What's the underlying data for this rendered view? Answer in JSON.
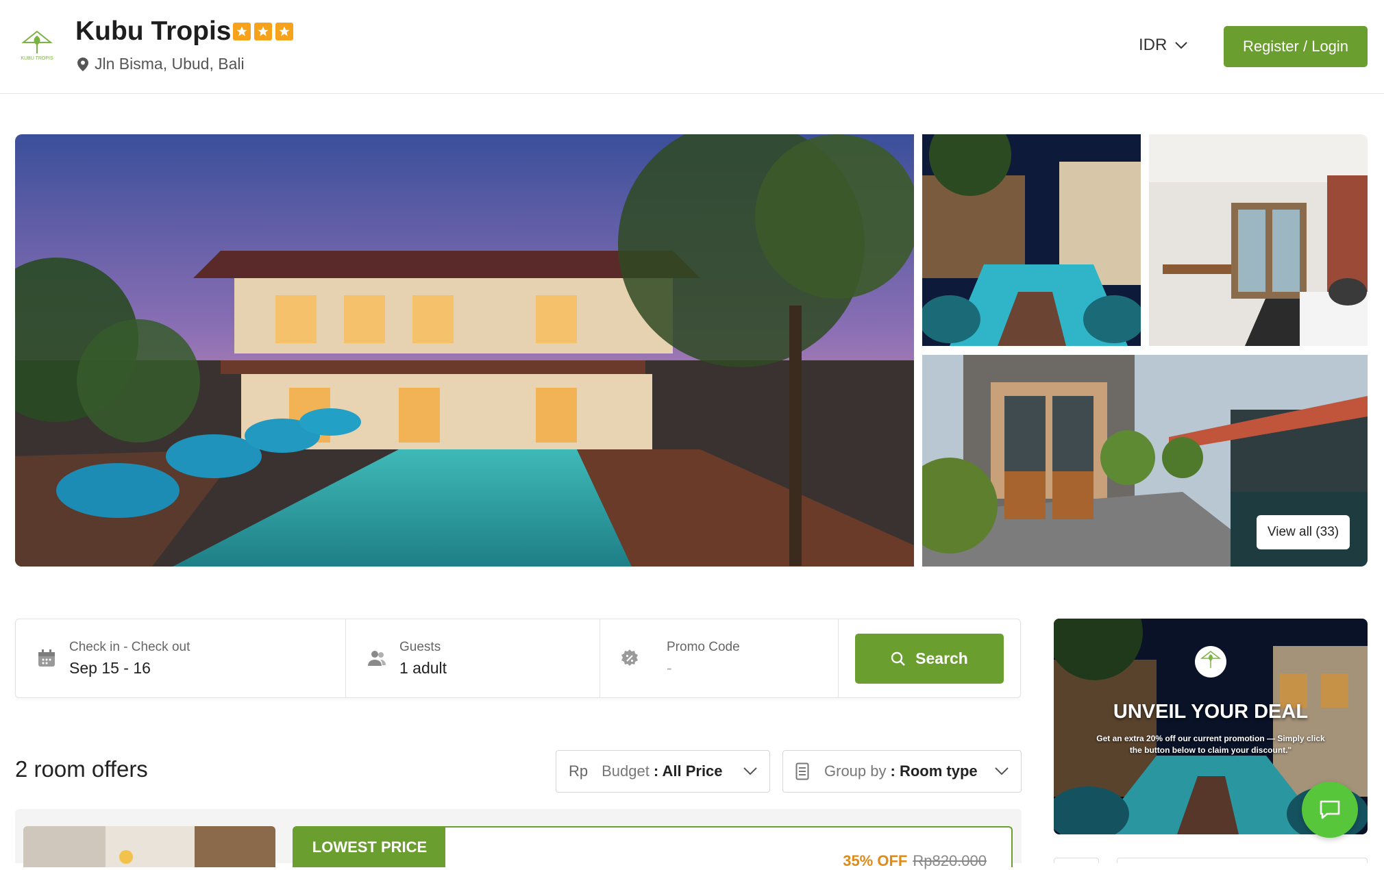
{
  "header": {
    "hotel_name": "Kubu Tropis",
    "star_rating": 3,
    "address": "Jln Bisma, Ubud, Bali",
    "currency": "IDR",
    "register_label": "Register / Login",
    "logo_text": "KUBU TROPIS"
  },
  "gallery": {
    "view_all_label": "View all (33)"
  },
  "search": {
    "dates_label": "Check in - Check out",
    "dates_value": "Sep 15 - 16",
    "guests_label": "Guests",
    "guests_value": "1 adult",
    "promo_label": "Promo Code",
    "promo_value": "-",
    "search_label": "Search"
  },
  "offers": {
    "title": "2 room offers",
    "budget_prefix": "Rp",
    "budget_label": "Budget",
    "budget_value": ": All Price",
    "group_label": "Group by",
    "group_value": ": Room type"
  },
  "listing": {
    "badge": "LOWEST PRICE",
    "discount_pct": "35% OFF",
    "original_price": "Rp820.000"
  },
  "promo_banner": {
    "title": "UNVEIL YOUR DEAL",
    "text": "Get an extra 20% off our current promotion — Simply click the button below to claim your discount.\""
  },
  "colors": {
    "brand_green": "#6a9e2e",
    "star_orange": "#f7a21b",
    "chat_green": "#58c63a",
    "discount_orange": "#e08a17"
  }
}
